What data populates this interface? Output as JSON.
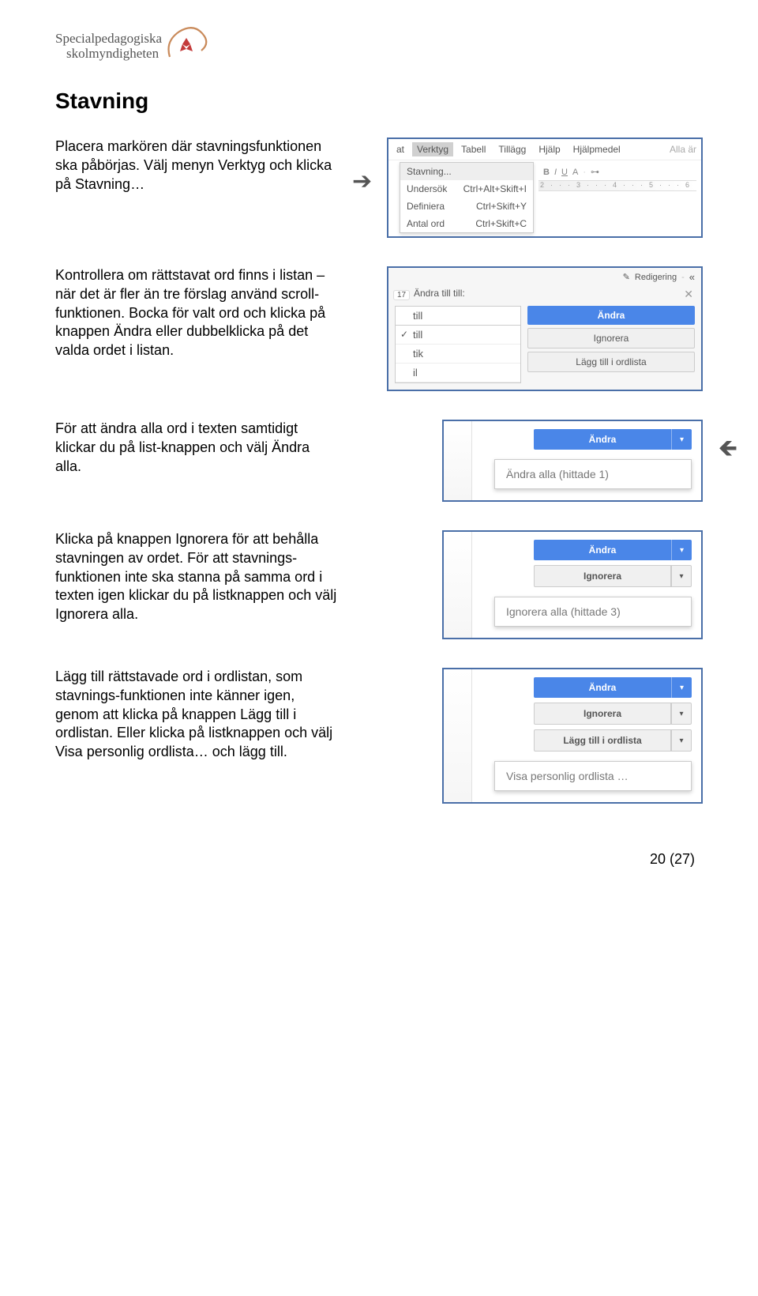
{
  "logo": {
    "line1": "Specialpedagogiska",
    "line2": "skolmyndigheten"
  },
  "heading": "Stavning",
  "para1": "Placera markören där stavningsfunktionen ska påbörjas. Välj menyn Verktyg och klicka på Stavning…",
  "para2": "Kontrollera om rättstavat ord finns i listan – när det är fler än tre förslag använd scroll-funktionen. Bocka för valt ord och klicka på knappen Ändra eller dubbelklicka på det valda ordet i listan.",
  "para3": "För att ändra alla ord i texten samtidigt klickar du på list-knappen och välj Ändra alla.",
  "para4": "Klicka på knappen Ignorera för att behålla stavningen av ordet. För att stavnings-funktionen inte ska stanna på samma ord i texten igen klickar du på listknappen och välj Ignorera alla.",
  "para5": "Lägg till rättstavade ord i ordlistan, som stavnings-funktionen inte känner igen, genom att klicka på knappen Lägg till i ordlistan. Eller klicka på listknappen och välj Visa personlig ordlista… och lägg till.",
  "fig1": {
    "menus": [
      "at",
      "Verktyg",
      "Tabell",
      "Tillägg",
      "Hjälp",
      "Hjälpmedel"
    ],
    "alla": "Alla är",
    "items": [
      {
        "label": "Stavning..."
      },
      {
        "label": "Undersök",
        "sc": "Ctrl+Alt+Skift+I"
      },
      {
        "label": "Definiera",
        "sc": "Ctrl+Skift+Y"
      },
      {
        "label": "Antal ord",
        "sc": "Ctrl+Skift+C"
      }
    ],
    "toolbar": "B  I  U  A",
    "ruler": "2···3···4···5···6"
  },
  "fig2": {
    "redigering": "Redigering",
    "header": "Ändra till till:",
    "input": "till",
    "suggestions": [
      "till",
      "tik",
      "il"
    ],
    "btn_andra": "Ändra",
    "btn_ignorera": "Ignorera",
    "btn_lagg": "Lägg till i ordlista",
    "tabnum": "17"
  },
  "fig3": {
    "btn_andra": "Ändra",
    "dropdown": "Ändra alla (hittade 1)"
  },
  "fig4": {
    "btn_andra": "Ändra",
    "btn_ignorera": "Ignorera",
    "dropdown": "Ignorera alla (hittade 3)"
  },
  "fig5": {
    "btn_andra": "Ändra",
    "btn_ignorera": "Ignorera",
    "btn_lagg": "Lägg till i ordlista",
    "dropdown": "Visa personlig ordlista …"
  },
  "pagenum": "20 (27)"
}
